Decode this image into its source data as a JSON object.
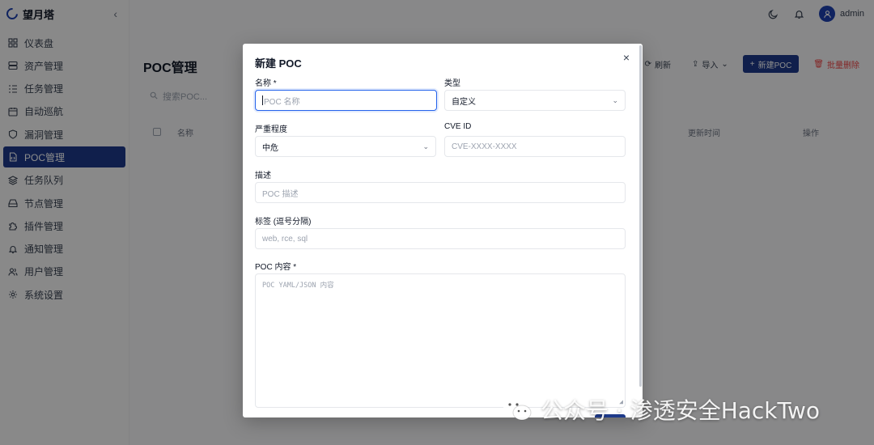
{
  "app": {
    "name": "望月塔"
  },
  "sidebar": {
    "items": [
      {
        "label": "仪表盘",
        "icon": "dashboard-icon"
      },
      {
        "label": "资产管理",
        "icon": "server-icon"
      },
      {
        "label": "任务管理",
        "icon": "list-icon"
      },
      {
        "label": "自动巡航",
        "icon": "calendar-icon"
      },
      {
        "label": "漏洞管理",
        "icon": "shield-icon"
      },
      {
        "label": "POC管理",
        "icon": "file-code-icon",
        "active": true
      },
      {
        "label": "任务队列",
        "icon": "layers-icon"
      },
      {
        "label": "节点管理",
        "icon": "hard-drive-icon"
      },
      {
        "label": "插件管理",
        "icon": "puzzle-icon"
      },
      {
        "label": "通知管理",
        "icon": "bell-icon"
      },
      {
        "label": "用户管理",
        "icon": "users-icon"
      },
      {
        "label": "系统设置",
        "icon": "gear-icon"
      }
    ]
  },
  "topbar": {
    "username": "admin"
  },
  "page": {
    "title": "POC管理",
    "search_placeholder": "搜索POC...",
    "actions": {
      "refresh": "刷新",
      "import": "导入",
      "new": "新建POC",
      "delete": "批量删除"
    },
    "table_columns": {
      "name": "名称",
      "updated": "更新时间",
      "ops": "操作"
    }
  },
  "modal": {
    "title": "新建 POC",
    "name_label": "名称 *",
    "name_placeholder": "POC 名称",
    "type_label": "类型",
    "type_value": "自定义",
    "severity_label": "严重程度",
    "severity_value": "中危",
    "cve_label": "CVE ID",
    "cve_placeholder": "CVE-XXXX-XXXX",
    "desc_label": "描述",
    "desc_placeholder": "POC 描述",
    "tags_label": "标签 (逗号分隔)",
    "tags_placeholder": "web, rce, sql",
    "content_label": "POC 内容 *",
    "content_placeholder": "POC YAML/JSON 内容"
  },
  "watermark": {
    "text": "公众号 · 渗透安全HackTwo"
  },
  "colors": {
    "primary": "#1e3a8a",
    "focus": "#2563eb",
    "danger": "#ef4444"
  }
}
